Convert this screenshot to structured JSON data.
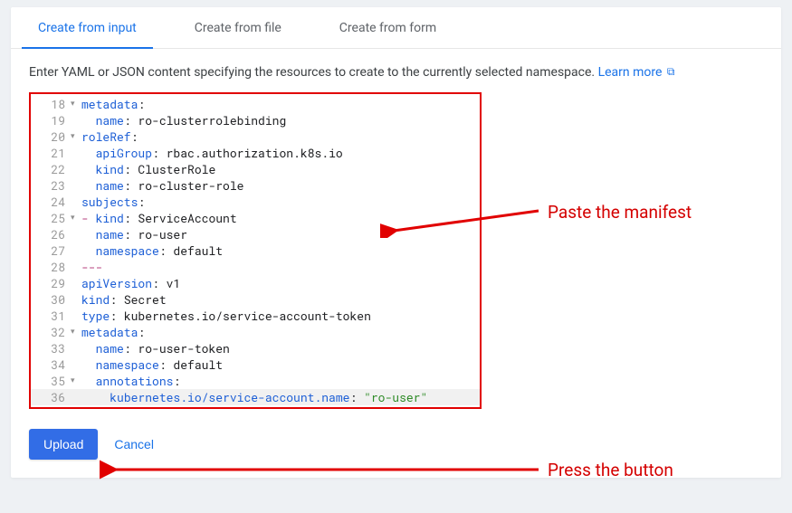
{
  "tabs": [
    {
      "label": "Create from input",
      "active": true
    },
    {
      "label": "Create from file",
      "active": false
    },
    {
      "label": "Create from form",
      "active": false
    }
  ],
  "description": "Enter YAML or JSON content specifying the resources to create to the currently selected namespace. ",
  "learn_more": "Learn more ",
  "editor": {
    "lines": [
      {
        "num": "18",
        "fold": "▾",
        "tokens": [
          [
            "k",
            "metadata"
          ],
          [
            "v",
            ":"
          ]
        ]
      },
      {
        "num": "19",
        "fold": "",
        "tokens": [
          [
            "v",
            "  "
          ],
          [
            "k",
            "name"
          ],
          [
            "v",
            ": ro-clusterrolebinding"
          ]
        ]
      },
      {
        "num": "20",
        "fold": "▾",
        "tokens": [
          [
            "k",
            "roleRef"
          ],
          [
            "v",
            ":"
          ]
        ]
      },
      {
        "num": "21",
        "fold": "",
        "tokens": [
          [
            "v",
            "  "
          ],
          [
            "k",
            "apiGroup"
          ],
          [
            "v",
            ": rbac.authorization.k8s.io"
          ]
        ]
      },
      {
        "num": "22",
        "fold": "",
        "tokens": [
          [
            "v",
            "  "
          ],
          [
            "k",
            "kind"
          ],
          [
            "v",
            ": ClusterRole"
          ]
        ]
      },
      {
        "num": "23",
        "fold": "",
        "tokens": [
          [
            "v",
            "  "
          ],
          [
            "k",
            "name"
          ],
          [
            "v",
            ": ro-cluster-role"
          ]
        ]
      },
      {
        "num": "24",
        "fold": "",
        "tokens": [
          [
            "k",
            "subjects"
          ],
          [
            "v",
            ":"
          ]
        ]
      },
      {
        "num": "25",
        "fold": "▾",
        "tokens": [
          [
            "p",
            "- "
          ],
          [
            "k",
            "kind"
          ],
          [
            "v",
            ": ServiceAccount"
          ]
        ]
      },
      {
        "num": "26",
        "fold": "",
        "tokens": [
          [
            "v",
            "  "
          ],
          [
            "k",
            "name"
          ],
          [
            "v",
            ": ro-user"
          ]
        ]
      },
      {
        "num": "27",
        "fold": "",
        "tokens": [
          [
            "v",
            "  "
          ],
          [
            "k",
            "namespace"
          ],
          [
            "v",
            ": default"
          ]
        ]
      },
      {
        "num": "28",
        "fold": "",
        "tokens": [
          [
            "p",
            "---"
          ]
        ]
      },
      {
        "num": "29",
        "fold": "",
        "tokens": [
          [
            "k",
            "apiVersion"
          ],
          [
            "v",
            ": v1"
          ]
        ]
      },
      {
        "num": "30",
        "fold": "",
        "tokens": [
          [
            "k",
            "kind"
          ],
          [
            "v",
            ": Secret"
          ]
        ]
      },
      {
        "num": "31",
        "fold": "",
        "tokens": [
          [
            "k",
            "type"
          ],
          [
            "v",
            ": kubernetes.io/service-account-token"
          ]
        ]
      },
      {
        "num": "32",
        "fold": "▾",
        "tokens": [
          [
            "k",
            "metadata"
          ],
          [
            "v",
            ":"
          ]
        ]
      },
      {
        "num": "33",
        "fold": "",
        "tokens": [
          [
            "v",
            "  "
          ],
          [
            "k",
            "name"
          ],
          [
            "v",
            ": ro-user-token"
          ]
        ]
      },
      {
        "num": "34",
        "fold": "",
        "tokens": [
          [
            "v",
            "  "
          ],
          [
            "k",
            "namespace"
          ],
          [
            "v",
            ": default"
          ]
        ]
      },
      {
        "num": "35",
        "fold": "▾",
        "tokens": [
          [
            "v",
            "  "
          ],
          [
            "k",
            "annotations"
          ],
          [
            "v",
            ":"
          ]
        ]
      },
      {
        "num": "36",
        "fold": "",
        "tokens": [
          [
            "v",
            "    "
          ],
          [
            "k",
            "kubernetes.io/service-account.name"
          ],
          [
            "v",
            ": "
          ],
          [
            "s",
            "\"ro-user\""
          ]
        ],
        "hl": true
      }
    ]
  },
  "buttons": {
    "upload": "Upload",
    "cancel": "Cancel"
  },
  "annotations": {
    "paste": "Paste the manifest",
    "press": "Press the button"
  }
}
